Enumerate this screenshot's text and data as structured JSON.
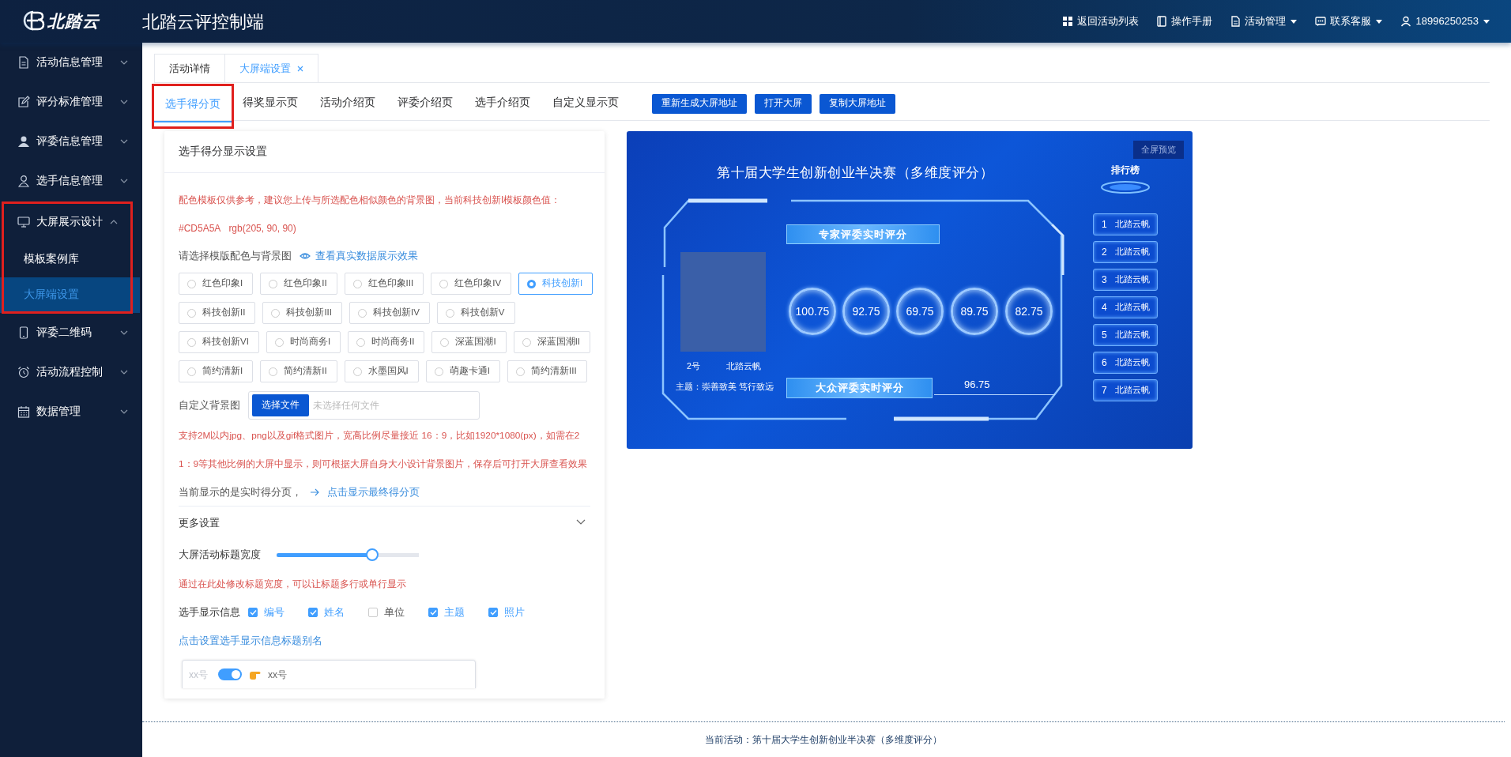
{
  "header": {
    "brand": "北踏云",
    "title": "北踏云评控制端",
    "menu": [
      {
        "label": "返回活动列表",
        "dropdown": false
      },
      {
        "label": "操作手册",
        "dropdown": false
      },
      {
        "label": "活动管理",
        "dropdown": true
      },
      {
        "label": "联系客服",
        "dropdown": true
      },
      {
        "label": "18996250253",
        "dropdown": true
      }
    ]
  },
  "sidebar": {
    "items": [
      {
        "label": "活动信息管理",
        "expanded": false,
        "highlighted": false
      },
      {
        "label": "评分标准管理",
        "expanded": false,
        "highlighted": false
      },
      {
        "label": "评委信息管理",
        "expanded": false,
        "highlighted": false
      },
      {
        "label": "选手信息管理",
        "expanded": false,
        "highlighted": false
      },
      {
        "label": "大屏展示设计",
        "expanded": true,
        "highlighted": true,
        "children": [
          {
            "label": "模板案例库",
            "selected": false
          },
          {
            "label": "大屏端设置",
            "selected": true
          }
        ]
      },
      {
        "label": "评委二维码",
        "expanded": false,
        "highlighted": false
      },
      {
        "label": "活动流程控制",
        "expanded": false,
        "highlighted": false
      },
      {
        "label": "数据管理",
        "expanded": false,
        "highlighted": false
      }
    ]
  },
  "page_tabs": [
    {
      "label": "活动详情",
      "selected": false,
      "closable": false
    },
    {
      "label": "大屏端设置",
      "selected": true,
      "closable": true
    }
  ],
  "sub_tabs": [
    {
      "label": "选手得分页",
      "selected": true,
      "highlighted": true
    },
    {
      "label": "得奖显示页",
      "selected": false,
      "highlighted": false
    },
    {
      "label": "活动介绍页",
      "selected": false,
      "highlighted": false
    },
    {
      "label": "评委介绍页",
      "selected": false,
      "highlighted": false
    },
    {
      "label": "选手介绍页",
      "selected": false,
      "highlighted": false
    },
    {
      "label": "自定义显示页",
      "selected": false,
      "highlighted": false
    }
  ],
  "actions": [
    "重新生成大屏地址",
    "打开大屏",
    "复制大屏地址"
  ],
  "settings": {
    "title": "选手得分显示设置",
    "notice": "配色模板仅供参考，建议您上传与所选配色相似颜色的背景图，当前科技创新I模板颜色值：",
    "color_hex": "#CD5A5A",
    "color_rgb": "rgb(205, 90, 90)",
    "template_label": "请选择模版配色与背景图",
    "preview_link": "查看真实数据展示效果",
    "template_rows": [
      {
        "options": [
          {
            "label": "红色印象I",
            "selected": false
          },
          {
            "label": "红色印象II",
            "selected": false
          },
          {
            "label": "红色印象III",
            "selected": false
          },
          {
            "label": "红色印象IV",
            "selected": false
          },
          {
            "label": "科技创新I",
            "selected": true
          }
        ]
      },
      {
        "options": [
          {
            "label": "科技创新II",
            "selected": false
          },
          {
            "label": "科技创新III",
            "selected": false
          },
          {
            "label": "科技创新IV",
            "selected": false
          },
          {
            "label": "科技创新V",
            "selected": false
          }
        ]
      },
      {
        "options": [
          {
            "label": "科技创新VI",
            "selected": false
          },
          {
            "label": "时尚商务I",
            "selected": false
          },
          {
            "label": "时尚商务II",
            "selected": false
          },
          {
            "label": "深蓝国潮I",
            "selected": false
          },
          {
            "label": "深蓝国潮II",
            "selected": false
          }
        ]
      },
      {
        "options": [
          {
            "label": "简约清新I",
            "selected": false
          },
          {
            "label": "简约清新II",
            "selected": false
          },
          {
            "label": "水墨国风I",
            "selected": false
          },
          {
            "label": "萌趣卡通I",
            "selected": false
          },
          {
            "label": "简约清新III",
            "selected": false
          }
        ]
      }
    ],
    "background": {
      "label": "自定义背景图",
      "button": "选择文件",
      "file_status": "未选择任何文件"
    },
    "upload_notice": "支持2M以内jpg、png以及gif格式图片，宽高比例尽量接近 16：9，比如1920*1080(px)，如需在21：9等其他比例的大屏中显示，则可根据大屏自身大小设计背景图片，保存后可打开大屏查看效果",
    "current_page_text": "当前显示的是实时得分页，",
    "final_page_link": "点击显示最终得分页",
    "more_settings": {
      "title": "更多设置",
      "expanded": true
    },
    "title_width": {
      "label": "大屏活动标题宽度",
      "level": 0.67
    },
    "width_notice": "通过在此处修改标题宽度，可以让标题多行或单行显示",
    "player_info": {
      "label": "选手显示信息",
      "options": [
        {
          "label": "编号",
          "checked": true
        },
        {
          "label": "姓名",
          "checked": true
        },
        {
          "label": "单位",
          "checked": false
        },
        {
          "label": "主题",
          "checked": true
        },
        {
          "label": "照片",
          "checked": true
        }
      ]
    },
    "alias_link": "点击设置选手显示信息标题别名",
    "alias_row": {
      "placeholder": "xx号",
      "on": true,
      "value": "xx号"
    }
  },
  "preview": {
    "fullscreen_button": "全屏预览",
    "title": "第十届大学生创新创业半决赛（多维度评分）",
    "ranking_title": "排行榜",
    "expert_banner": "专家评委实时评分",
    "public_banner": "大众评委实时评分",
    "player": {
      "number": "2号",
      "name": "北踏云帆",
      "theme": "主题：崇善致美 笃行致远"
    },
    "expert_scores": [
      "100.75",
      "92.75",
      "69.75",
      "89.75",
      "82.75"
    ],
    "public_score": "96.75",
    "ranking": [
      {
        "rank": "1",
        "name": "北踏云帆"
      },
      {
        "rank": "2",
        "name": "北踏云帆"
      },
      {
        "rank": "3",
        "name": "北踏云帆"
      },
      {
        "rank": "4",
        "name": "北踏云帆"
      },
      {
        "rank": "5",
        "name": "北踏云帆"
      },
      {
        "rank": "6",
        "name": "北踏云帆"
      },
      {
        "rank": "7",
        "name": "北踏云帆"
      }
    ]
  },
  "footer": "当前活动：第十届大学生创新创业半决赛（多维度评分）"
}
